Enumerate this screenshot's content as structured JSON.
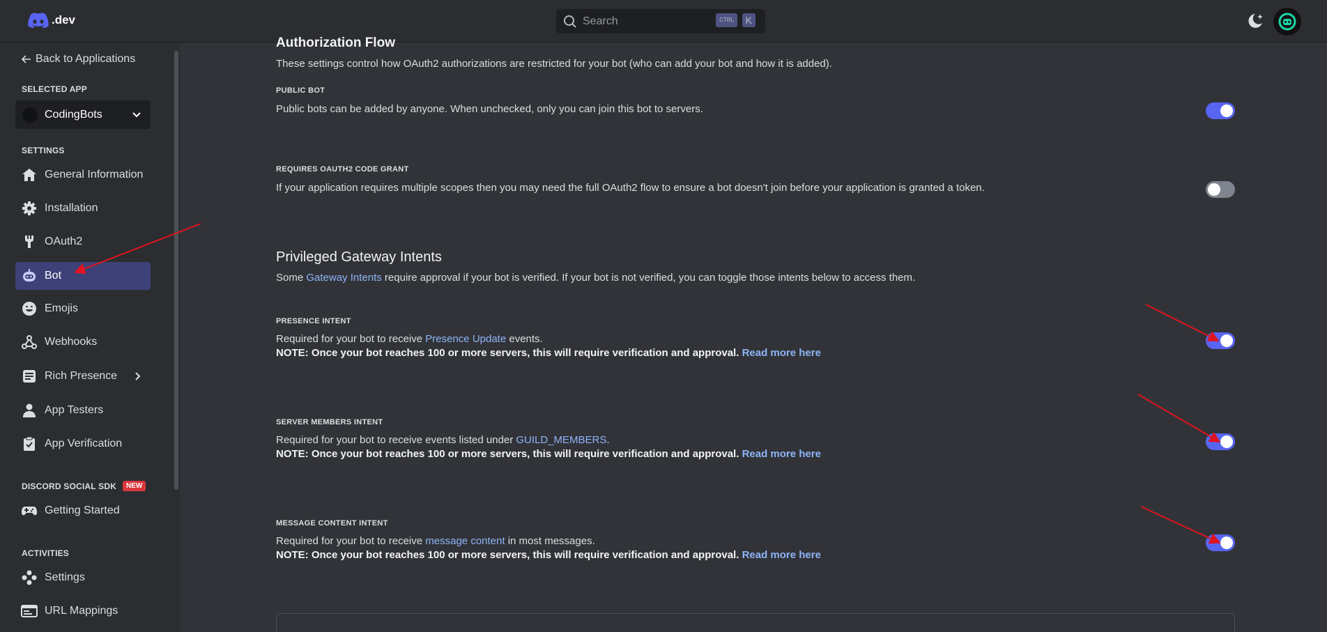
{
  "topbar": {
    "logo_text": ".dev",
    "search_placeholder": "Search",
    "shortcut_ctrl": "CTRL",
    "shortcut_k": "K"
  },
  "sidebar": {
    "back_label": "Back to Applications",
    "selected_app_label": "SELECTED APP",
    "app_name": "CodingBots",
    "settings_label": "SETTINGS",
    "items": [
      {
        "label": "General Information",
        "icon": "home-icon"
      },
      {
        "label": "Installation",
        "icon": "gear-icon"
      },
      {
        "label": "OAuth2",
        "icon": "wrench-icon"
      },
      {
        "label": "Bot",
        "icon": "bot-icon"
      },
      {
        "label": "Emojis",
        "icon": "emoji-icon"
      },
      {
        "label": "Webhooks",
        "icon": "webhooks-icon"
      },
      {
        "label": "Rich Presence",
        "icon": "document-icon"
      },
      {
        "label": "App Testers",
        "icon": "person-icon"
      },
      {
        "label": "App Verification",
        "icon": "clipboard-check-icon"
      }
    ],
    "social_sdk_label": "DISCORD SOCIAL SDK",
    "new_badge": "NEW",
    "sdk_items": [
      {
        "label": "Getting Started",
        "icon": "gamepad-icon"
      }
    ],
    "activities_label": "ACTIVITIES",
    "activity_items": [
      {
        "label": "Settings",
        "icon": "activities-icon"
      },
      {
        "label": "URL Mappings",
        "icon": "url-mapping-icon"
      }
    ]
  },
  "auth": {
    "title": "Authorization Flow",
    "description": "These settings control how OAuth2 authorizations are restricted for your bot (who can add your bot and how it is added).",
    "public_bot_label": "PUBLIC BOT",
    "public_bot_desc": "Public bots can be added by anyone. When unchecked, only you can join this bot to servers.",
    "public_bot_on": true,
    "code_grant_label": "REQUIRES OAUTH2 CODE GRANT",
    "code_grant_desc": "If your application requires multiple scopes then you may need the full OAuth2 flow to ensure a bot doesn't join before your application is granted a token.",
    "code_grant_on": false
  },
  "intents": {
    "title": "Privileged Gateway Intents",
    "desc_pre": "Some ",
    "desc_link": "Gateway Intents",
    "desc_post": " require approval if your bot is verified. If your bot is not verified, you can toggle those intents below to access them.",
    "note": "NOTE: Once your bot reaches 100 or more servers, this will require verification and approval.",
    "read_more": "Read more here",
    "presence": {
      "label": "PRESENCE INTENT",
      "pre": "Required for your bot to receive ",
      "link": "Presence Update",
      "post": " events.",
      "on": true
    },
    "members": {
      "label": "SERVER MEMBERS INTENT",
      "pre": "Required for your bot to receive events listed under ",
      "link": "GUILD_MEMBERS",
      "post": ".",
      "on": true
    },
    "message": {
      "label": "MESSAGE CONTENT INTENT",
      "pre": "Required for your bot to receive ",
      "link": "message content",
      "post": " in most messages.",
      "on": true
    }
  },
  "colors": {
    "accent": "#5865f2",
    "annotation": "#e0141e"
  }
}
